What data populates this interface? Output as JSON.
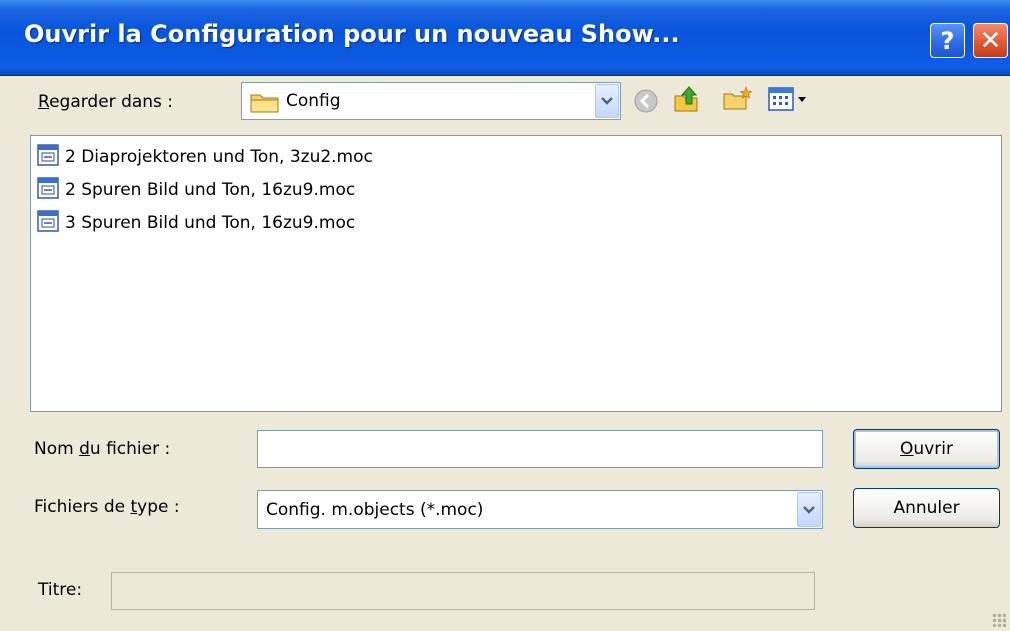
{
  "window": {
    "title": "Ouvrir la Configuration pour un nouveau Show...",
    "help_label": "?",
    "close_label": "✕"
  },
  "look_in": {
    "label_pre": "",
    "label_key": "R",
    "label_post": "egarder dans :",
    "value": "Config",
    "icon": "folder-icon"
  },
  "toolbar": {
    "back_icon": "back-arrow-icon",
    "up_icon": "up-folder-icon",
    "new_folder_icon": "new-folder-icon",
    "views_icon": "view-menu-icon"
  },
  "files": [
    {
      "name": "2 Diaprojektoren und Ton, 3zu2.moc",
      "icon": "moc-file-icon"
    },
    {
      "name": "2 Spuren Bild und Ton, 16zu9.moc",
      "icon": "moc-file-icon"
    },
    {
      "name": "3 Spuren Bild und Ton, 16zu9.moc",
      "icon": "moc-file-icon"
    }
  ],
  "filename": {
    "label_pre": "Nom ",
    "label_key": "d",
    "label_post": "u fichier :",
    "value": ""
  },
  "filetype": {
    "label_pre": "Fichiers de ",
    "label_key": "t",
    "label_post": "ype :",
    "value": "Config. m.objects (*.moc)"
  },
  "buttons": {
    "open_key": "O",
    "open_rest": "uvrir",
    "cancel": "Annuler"
  },
  "title_field": {
    "label": "Titre:",
    "value": ""
  },
  "colors": {
    "titlebar": "#0856dc",
    "dialog_bg": "#ECE9D8",
    "field_border": "#7F9DB9"
  }
}
